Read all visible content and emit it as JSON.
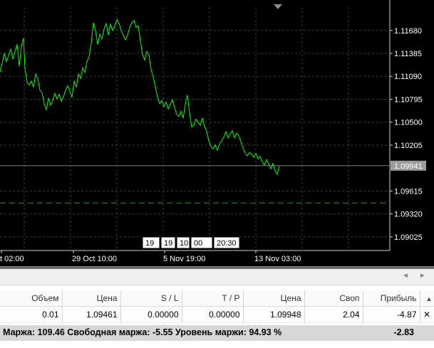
{
  "chart": {
    "price_labels": [
      "1.11680",
      "1.11385",
      "1.11090",
      "1.10795",
      "1.10500",
      "1.10205",
      "1.09615",
      "1.09320",
      "1.09025"
    ],
    "current_price": "1.09941",
    "time_labels": [
      "t 02:00",
      "29 Oct 10:00",
      "5 Nov 19:00",
      "13 Nov 03:00"
    ],
    "scroll_labels": [
      "19",
      "19",
      "10",
      "00",
      "20:30"
    ],
    "line_color": "#00ff00",
    "grid_color": "#3a3a3a"
  },
  "chart_data": {
    "type": "line",
    "title": "",
    "xlabel": "",
    "ylabel": "",
    "ylim": [
      1.0885,
      1.1198
    ],
    "x": [
      0,
      3,
      6,
      9,
      12,
      15,
      18,
      21,
      24,
      27,
      30,
      33,
      35,
      38,
      41,
      44,
      47,
      50,
      53,
      56,
      59,
      62,
      65,
      68,
      71,
      74,
      77,
      80,
      83,
      86,
      89,
      92,
      95,
      98,
      101,
      104,
      107,
      110,
      113,
      116,
      119,
      122,
      125,
      128,
      131,
      134,
      137,
      140,
      143,
      146,
      149,
      152,
      155,
      158,
      161,
      164,
      167,
      170,
      173,
      176,
      179,
      182,
      185,
      188,
      191,
      194,
      197,
      200,
      203,
      206,
      209,
      212,
      215,
      218,
      221,
      224,
      227,
      230,
      233,
      236,
      239,
      242,
      245,
      248,
      251,
      254,
      257,
      260,
      263,
      266,
      269,
      272,
      275,
      278,
      281,
      284,
      287,
      290,
      293,
      296,
      299,
      302,
      305,
      308,
      311,
      314,
      317,
      320,
      323,
      326,
      329,
      332,
      335,
      338,
      341,
      344,
      347,
      350,
      353,
      356,
      359,
      362,
      365,
      368,
      371,
      374,
      377,
      380,
      383,
      386,
      389,
      392
    ],
    "series": [
      {
        "values": [
          1.1115,
          1.1126,
          1.1139,
          1.1128,
          1.1136,
          1.1144,
          1.1131,
          1.1141,
          1.115,
          1.1122,
          1.1148,
          1.1158,
          1.112,
          1.1101,
          1.1098,
          1.1103,
          1.1095,
          1.1112,
          1.1106,
          1.1091,
          1.1088,
          1.1074,
          1.1066,
          1.1081,
          1.1072,
          1.1078,
          1.1087,
          1.108,
          1.1086,
          1.1077,
          1.1083,
          1.1091,
          1.1097,
          1.109,
          1.1082,
          1.1103,
          1.1095,
          1.1112,
          1.1106,
          1.112,
          1.1114,
          1.1128,
          1.1134,
          1.1152,
          1.1178,
          1.1168,
          1.115,
          1.1163,
          1.1157,
          1.117,
          1.1177,
          1.1162,
          1.1176,
          1.1168,
          1.1173,
          1.1182,
          1.1177,
          1.1168,
          1.1162,
          1.1156,
          1.1162,
          1.1172,
          1.1178,
          1.1181,
          1.1172,
          1.1174,
          1.1155,
          1.1137,
          1.113,
          1.1141,
          1.1136,
          1.1118,
          1.1108,
          1.1096,
          1.1082,
          1.1074,
          1.1078,
          1.107,
          1.1076,
          1.1067,
          1.1073,
          1.1079,
          1.1069,
          1.106,
          1.1057,
          1.1064,
          1.1055,
          1.1073,
          1.1085,
          1.1062,
          1.1044,
          1.1046,
          1.1054,
          1.105,
          1.1046,
          1.1055,
          1.1045,
          1.1038,
          1.1026,
          1.1019,
          1.1016,
          1.1021,
          1.1014,
          1.1022,
          1.1026,
          1.1031,
          1.1038,
          1.103,
          1.1035,
          1.1039,
          1.103,
          1.1036,
          1.1033,
          1.1025,
          1.1017,
          1.101,
          1.1007,
          1.1011,
          1.1009,
          1.1005,
          1.101,
          1.1003,
          1.1006,
          1.0999,
          1.0995,
          1.1002,
          1.0997,
          1.099,
          1.0997,
          1.0988,
          1.0983,
          1.0994
        ]
      }
    ],
    "hlines": [
      {
        "label": "current price",
        "value": 1.09941,
        "style": "solid",
        "color": "#808080"
      },
      {
        "label": "order level",
        "value": 1.09461,
        "style": "dashed",
        "color": "#00b400"
      }
    ],
    "grid": true
  },
  "terminal": {
    "headers": [
      "Объем",
      "Цена",
      "S / L",
      "T / P",
      "Цена",
      "Своп",
      "Прибыль"
    ],
    "row": [
      "0.01",
      "1.09461",
      "0.00000",
      "0.00000",
      "1.09948",
      "2.04",
      "-4.87"
    ],
    "summary": "Маржа: 109.46  Свободная маржа: -5.55  Уровень маржи: 94.93 %",
    "total": "-2.83",
    "close_glyph": "✕",
    "sort_glyph": "▲",
    "prev_glyph": "◄",
    "next_glyph": "►"
  }
}
